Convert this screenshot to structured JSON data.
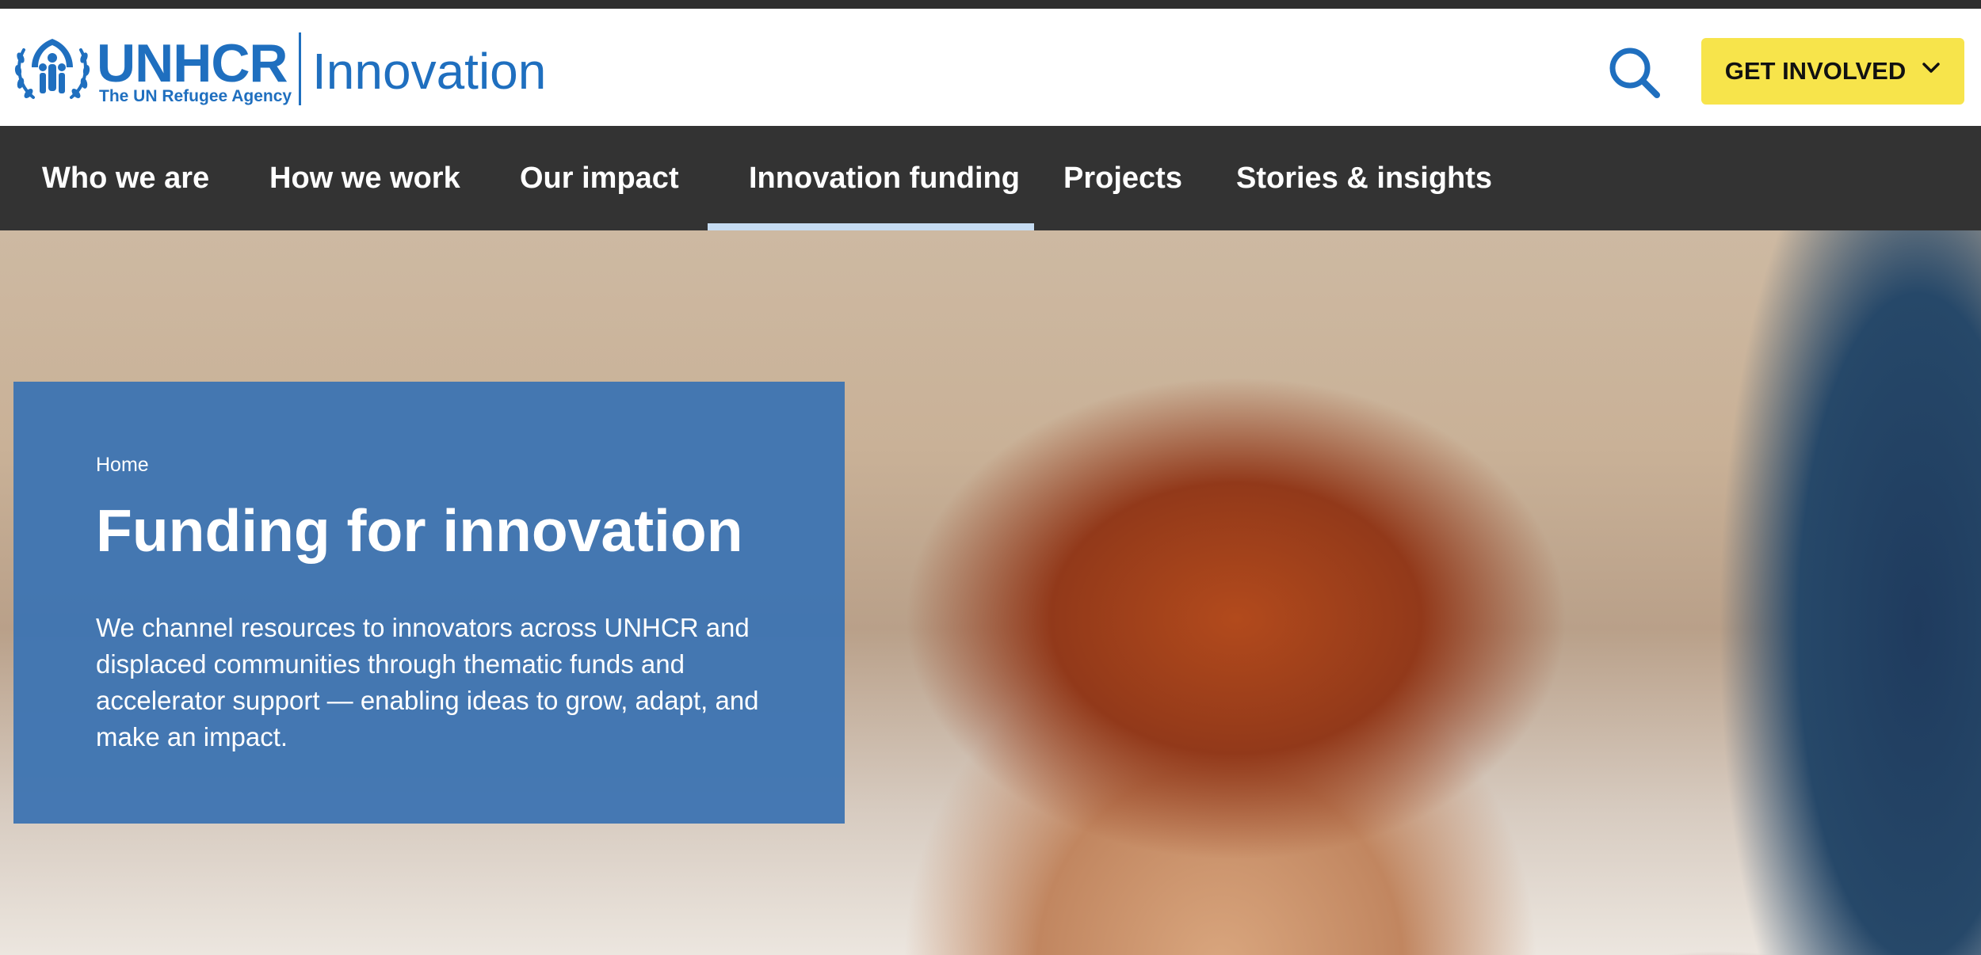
{
  "header": {
    "brand_name": "UNHCR",
    "brand_tagline": "The UN Refugee Agency",
    "site_name": "Innovation",
    "logo_icon": "unhcr-emblem-icon",
    "search_icon": "search-icon",
    "cta_label": "GET INVOLVED",
    "cta_icon": "chevron-down-icon"
  },
  "nav": {
    "items": [
      {
        "label": "Who we are",
        "active": false
      },
      {
        "label": "How we work",
        "active": false
      },
      {
        "label": "Our impact",
        "active": false
      },
      {
        "label": "Innovation funding",
        "active": true
      },
      {
        "label": "Projects",
        "active": false
      },
      {
        "label": "Stories & insights",
        "active": false
      }
    ]
  },
  "hero": {
    "breadcrumb": "Home",
    "title": "Funding for innovation",
    "description": "We channel resources to innovators across UNHCR and displaced communities through thematic funds and accelerator support — enabling ideas to grow, adapt, and make an impact."
  },
  "colors": {
    "brand_blue": "#1f6fbf",
    "cta_yellow": "#f7e44b",
    "nav_bg": "#333333",
    "nav_active_underline": "#c6dcf2",
    "hero_panel_blue": "#3e75b2"
  }
}
